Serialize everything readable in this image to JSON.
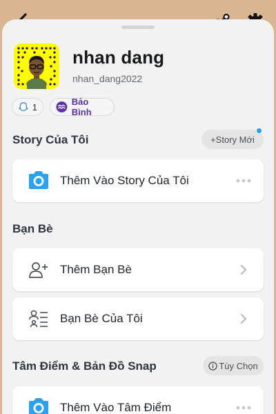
{
  "header": {
    "back_icon": "chevron-left-icon",
    "share_icon": "share-icon",
    "settings_icon": "gear-icon"
  },
  "profile": {
    "display_name": "nhan dang",
    "username": "nhan_dang2022",
    "snapcode_color": "#fffc00",
    "friends_count": "1",
    "zodiac": "Bảo Bình"
  },
  "story_section": {
    "title": "Story Của Tôi",
    "new_story_label": "+Story Mới",
    "add_item": "Thêm Vào Story Của Tôi"
  },
  "friends_section": {
    "title": "Bạn Bè",
    "add_friends": "Thêm Bạn Bè",
    "my_friends": "Bạn Bè Của Tôi"
  },
  "spotlight_section": {
    "title": "Tâm Điểm & Bản Đồ Snap",
    "options_label": "Tùy Chọn",
    "add_item": "Thêm Vào Tâm Điểm"
  },
  "colors": {
    "background": "#d9b592",
    "accent_blue": "#21a1f1",
    "zodiac_purple": "#5b2fa8"
  }
}
